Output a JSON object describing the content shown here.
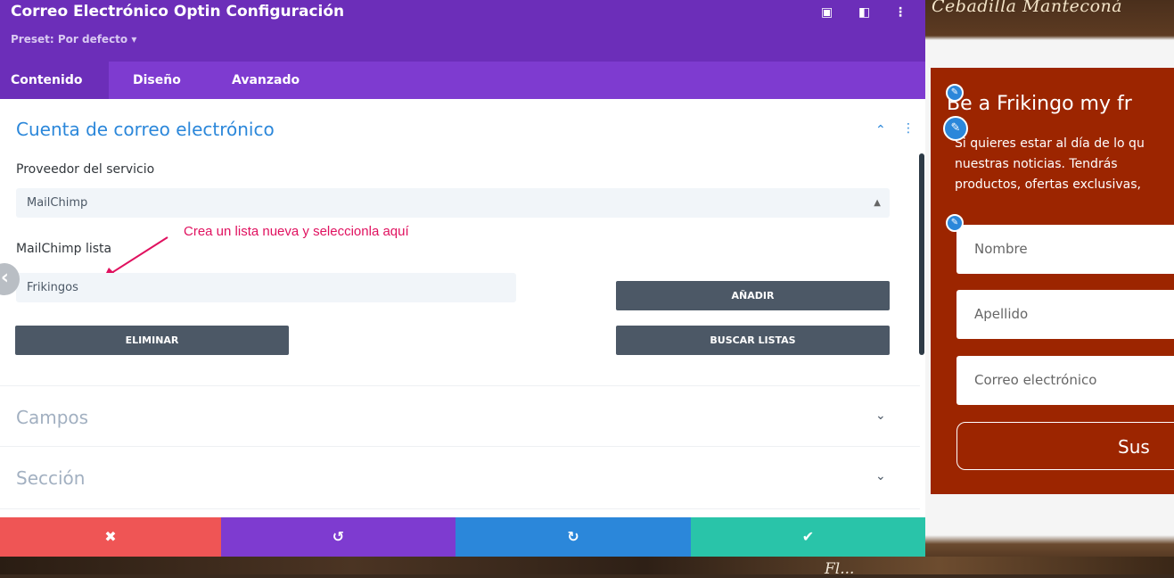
{
  "panel": {
    "title": "Correo Electrónico Optin Configuración",
    "preset": "Preset: Por defecto ▾",
    "tabs": [
      "Contenido",
      "Diseño",
      "Avanzado"
    ],
    "section_title": "Cuenta de correo electrónico",
    "provider_label": "Proveedor del servicio",
    "provider_value": "MailChimp",
    "list_label": "MailChimp lista",
    "list_value": "Frikingos",
    "add_button": "AÑADIR",
    "delete_button": "ELIMINAR",
    "search_button": "BUSCAR LISTAS",
    "annotation": "Crea un lista nueva y seleccionla aquí",
    "collapsed_sections": [
      "Campos",
      "Sección"
    ]
  },
  "preview": {
    "header_text": "Cebadilla Manteconá",
    "title": "Be a Frikingo my fr",
    "description_lines": [
      "Si quieres estar al día de lo qu",
      "nuestras  noticias.  Tendrás",
      "productos, ofertas exclusivas,"
    ],
    "fields": [
      "Nombre",
      "Apellido",
      "Correo electrónico"
    ],
    "submit": "Sus",
    "bottom_text": "Fl..."
  },
  "colors": {
    "header": "#6c2eb9",
    "tabs": "#7e3bd0",
    "cancel": "#ef5555",
    "undo": "#7e3bd0",
    "redo": "#2b87da",
    "save": "#29c4a9",
    "optin_bg": "#9c2500"
  },
  "icons": [
    "focus-icon",
    "split-view-icon",
    "more-options-icon",
    "chevron-up-icon",
    "chevron-down-icon",
    "close-icon",
    "undo-icon",
    "redo-icon",
    "check-icon",
    "pencil-icon"
  ]
}
